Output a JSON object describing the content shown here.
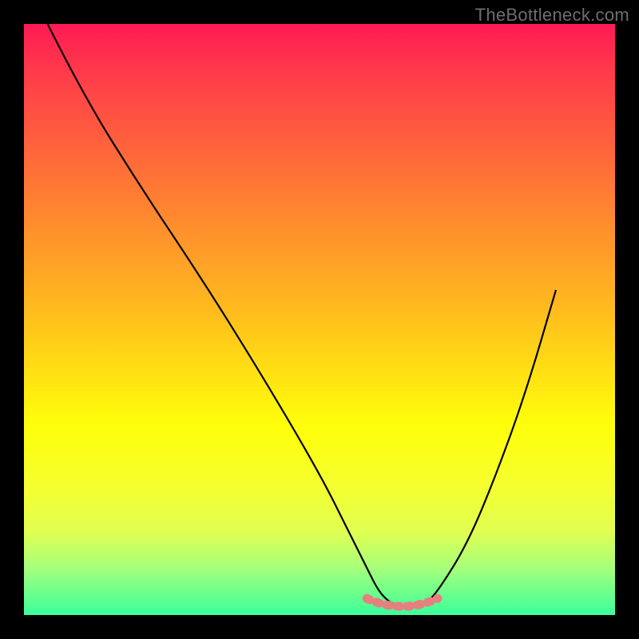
{
  "watermark": "TheBottleneck.com",
  "colors": {
    "line": "#000000",
    "flat_marker": "#e77f7f",
    "bg_black": "#000000"
  },
  "chart_data": {
    "type": "line",
    "title": "",
    "xlabel": "",
    "ylabel": "",
    "xlim": [
      0,
      100
    ],
    "ylim": [
      0,
      100
    ],
    "series": [
      {
        "name": "main-curve",
        "x": [
          4,
          10,
          20,
          30,
          40,
          50,
          55,
          58,
          60,
          62,
          64,
          66,
          68,
          70,
          75,
          80,
          85,
          90
        ],
        "values": [
          100,
          88,
          72,
          57,
          41,
          24,
          14,
          8,
          4,
          2,
          1.5,
          1.5,
          2,
          4,
          12,
          24,
          38,
          55
        ]
      }
    ],
    "flat_segment": {
      "x_start": 58,
      "x_end": 70,
      "y": 2
    }
  }
}
